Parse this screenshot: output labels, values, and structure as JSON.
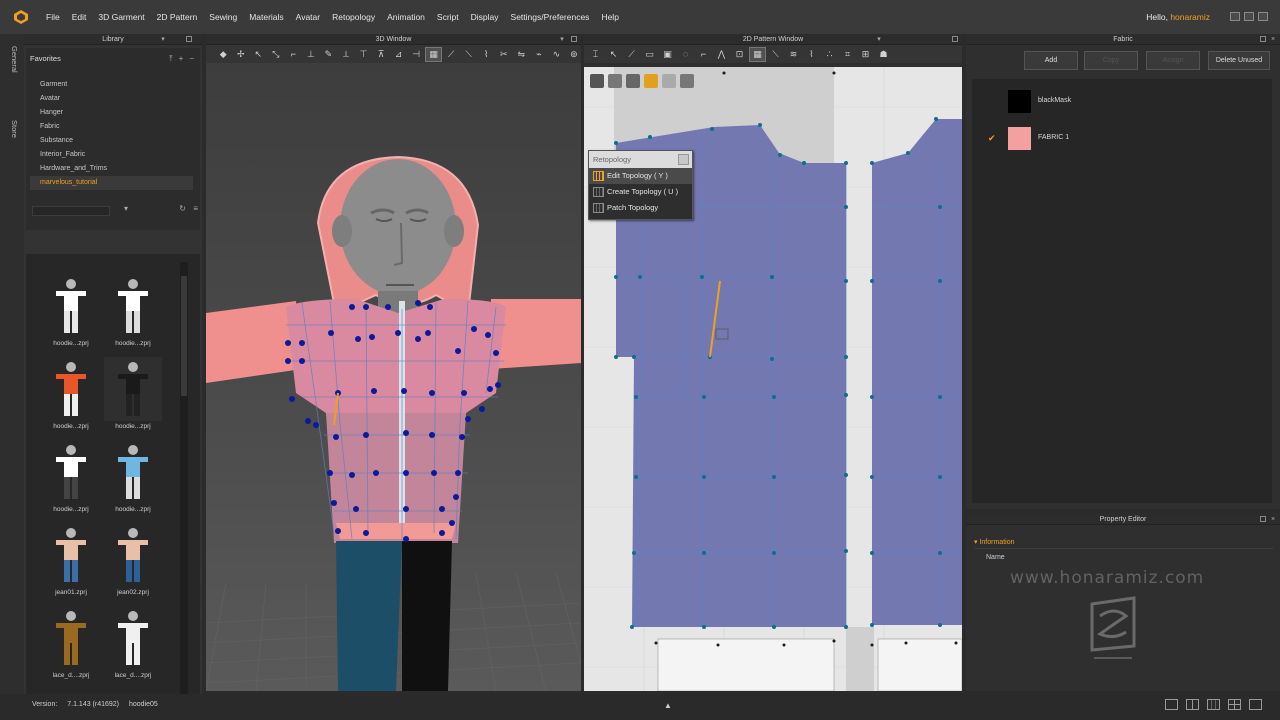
{
  "menu": [
    "File",
    "Edit",
    "3D Garment",
    "2D Pattern",
    "Sewing",
    "Materials",
    "Avatar",
    "Retopology",
    "Animation",
    "Script",
    "Display",
    "Settings/Preferences",
    "Help"
  ],
  "greeting": {
    "prefix": "Hello, ",
    "user": "honaramiz"
  },
  "side_tabs": [
    "General",
    "Store"
  ],
  "library": {
    "title": "Library",
    "favorites_title": "Favorites",
    "favorites": [
      "Garment",
      "Avatar",
      "Hanger",
      "Fabric",
      "Substance",
      "Interior_Fabric",
      "Hardware_and_Trims",
      "marvelous_tutorial"
    ],
    "items": [
      {
        "label": "hoodie...zprj",
        "shirt": "#ffffff",
        "pants": "#e8e8e8"
      },
      {
        "label": "hoodie...zprj",
        "shirt": "#ffffff",
        "pants": "#dddddd"
      },
      {
        "label": "hoodie...zprj",
        "shirt": "#e8562a",
        "pants": "#f0f0f0"
      },
      {
        "label": "hoodie...zprj",
        "shirt": "#1a1a1a",
        "pants": "#222222"
      },
      {
        "label": "hoodie...zprj",
        "shirt": "#ffffff",
        "pants": "#444444"
      },
      {
        "label": "hoodie...zprj",
        "shirt": "#6fb7e0",
        "pants": "#dddddd"
      },
      {
        "label": "jean01.zprj",
        "shirt": "#e8c0a8",
        "pants": "#3a6fa8"
      },
      {
        "label": "jean02.zprj",
        "shirt": "#e8c0a8",
        "pants": "#2e5f96"
      },
      {
        "label": "lace_d....zprj",
        "shirt": "#9a6a20",
        "pants": "#9a6a20"
      },
      {
        "label": "lace_d....zprj",
        "shirt": "#f0f0f0",
        "pants": "#f0f0f0"
      },
      {
        "label": "",
        "shirt": "#4a8a3a",
        "pants": "#e8c0a8"
      },
      {
        "label": "",
        "shirt": "#4a8a3a",
        "pants": "#e8c0a8"
      }
    ]
  },
  "view3d": {
    "title": "3D Window"
  },
  "view2d": {
    "title": "2D Pattern Window"
  },
  "retopology_popup": {
    "title": "Retopology",
    "items": [
      "Edit Topology ( Y )",
      "Create Topology ( U )",
      "Patch Topology"
    ]
  },
  "fabric": {
    "title": "Fabric",
    "buttons": [
      "Add",
      "Copy",
      "Assign",
      "Delete Unused"
    ],
    "items": [
      {
        "name": "blackMask",
        "color": "#000000",
        "checked": false
      },
      {
        "name": "FABRIC 1",
        "color": "#f4a0a0",
        "checked": true
      }
    ]
  },
  "property_editor": {
    "title": "Property Editor",
    "section": "Information",
    "name_label": "Name"
  },
  "watermark": "www.honaramiz.com",
  "status": {
    "version_label": "Version:",
    "version": "7.1.143 (r41692)",
    "file": "hoodie05"
  },
  "colors": {
    "accent": "#f0a020",
    "pattern_fill": "#7478b0",
    "vertex": "#0a1a9a",
    "edge_highlight": "#f0a020",
    "hoodie": "#f0908e"
  }
}
